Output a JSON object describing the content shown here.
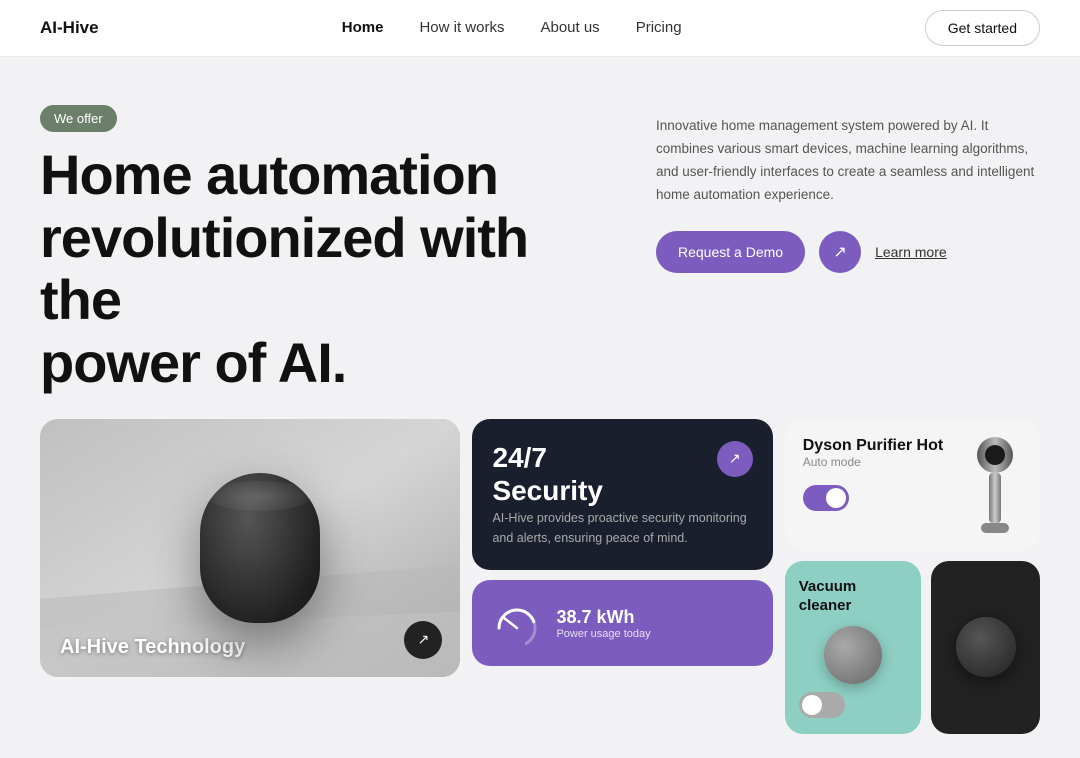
{
  "nav": {
    "logo": "AI-Hive",
    "links": [
      {
        "label": "Home",
        "active": true
      },
      {
        "label": "How it works",
        "active": false
      },
      {
        "label": "About us",
        "active": false
      },
      {
        "label": "Pricing",
        "active": false
      }
    ],
    "cta": "Get started"
  },
  "hero": {
    "badge": "We offer",
    "title_line1": "Home automation",
    "title_line2": "revolutionized with the",
    "title_line3": "power of AI.",
    "description": "Innovative home management system powered by AI. It combines various smart devices, machine learning algorithms, and user-friendly interfaces to create a seamless and intelligent home automation experience.",
    "btn_demo": "Request a Demo",
    "btn_learn": "Learn more"
  },
  "cards": {
    "device": {
      "label": "AI-Hive Technology"
    },
    "security": {
      "title_line1": "24/7",
      "title_line2": "Security",
      "description": "AI-Hive provides proactive security monitoring and alerts, ensuring peace of mind."
    },
    "power": {
      "value": "38.7 kWh",
      "label": "Power usage today"
    },
    "dyson": {
      "name": "Dyson Purifier Hot",
      "mode": "Auto mode",
      "toggle": "on"
    },
    "vacuum": {
      "name": "Vacuum cleaner",
      "toggle": "off"
    }
  },
  "colors": {
    "accent": "#7c5cbf",
    "dark": "#1a1f2e",
    "teal": "#8ecfc4",
    "badge_green": "#6b7f6b"
  }
}
